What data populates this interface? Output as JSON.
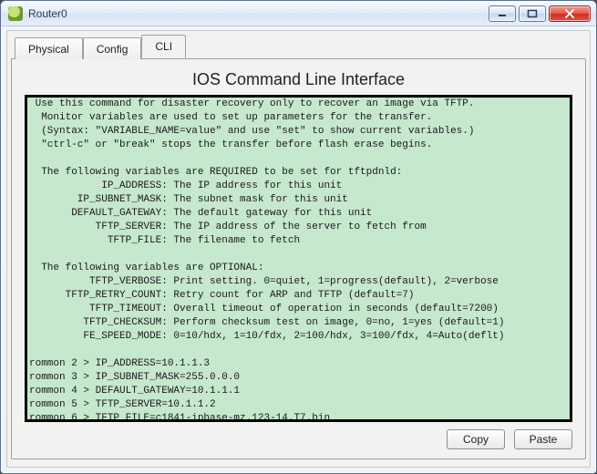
{
  "window": {
    "title": "Router0"
  },
  "tabs": {
    "physical": "Physical",
    "config": "Config",
    "cli": "CLI"
  },
  "panel": {
    "title": "IOS Command Line Interface"
  },
  "terminal_text": " Use this command for disaster recovery only to recover an image via TFTP.\n  Monitor variables are used to set up parameters for the transfer.\n  (Syntax: \"VARIABLE_NAME=value\" and use \"set\" to show current variables.)\n  \"ctrl-c\" or \"break\" stops the transfer before flash erase begins.\n\n  The following variables are REQUIRED to be set for tftpdnld:\n            IP_ADDRESS: The IP address for this unit\n        IP_SUBNET_MASK: The subnet mask for this unit\n       DEFAULT_GATEWAY: The default gateway for this unit\n           TFTP_SERVER: The IP address of the server to fetch from\n             TFTP_FILE: The filename to fetch\n\n  The following variables are OPTIONAL:\n          TFTP_VERBOSE: Print setting. 0=quiet, 1=progress(default), 2=verbose\n      TFTP_RETRY_COUNT: Retry count for ARP and TFTP (default=7)\n          TFTP_TIMEOUT: Overall timeout of operation in seconds (default=7200)\n         TFTP_CHECKSUM: Perform checksum test on image, 0=no, 1=yes (default=1)\n         FE_SPEED_MODE: 0=10/hdx, 1=10/fdx, 2=100/hdx, 3=100/fdx, 4=Auto(deflt)\n\nrommon 2 > IP_ADDRESS=10.1.1.3\nrommon 3 > IP_SUBNET_MASK=255.0.0.0\nrommon 4 > DEFAULT_GATEWAY=10.1.1.1\nrommon 5 > TFTP_SERVER=10.1.1.2\nrommon 6 > TFTP_FILE=c1841-ipbase-mz.123-14.T7.bin",
  "buttons": {
    "copy": "Copy",
    "paste": "Paste"
  }
}
